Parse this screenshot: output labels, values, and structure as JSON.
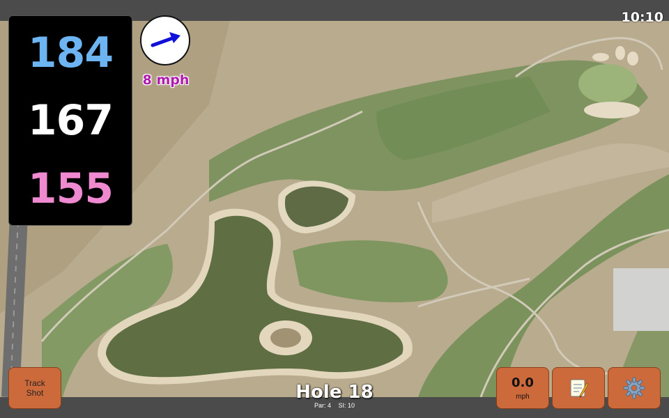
{
  "status_bar": {
    "time": "10:10"
  },
  "distances": {
    "back": {
      "value": "184",
      "color": "#6cb4f2"
    },
    "middle": {
      "value": "167",
      "color": "#ffffff"
    },
    "front": {
      "value": "155",
      "color": "#f08ad0"
    }
  },
  "wind": {
    "speed_label": "8 mph",
    "arrow_icon": "wind-arrow-icon",
    "arrow_color": "#1010d8",
    "label_color": "#b01ab0"
  },
  "hole": {
    "title": "Hole 18",
    "par": "Par: 4",
    "si": "SI: 10"
  },
  "buttons": {
    "track_shot": "Track Shot",
    "speed_value": "0.0",
    "speed_unit": "mph",
    "notes_icon": "notepad-icon",
    "settings_icon": "gear-icon",
    "accent": "#cd6a3b"
  }
}
